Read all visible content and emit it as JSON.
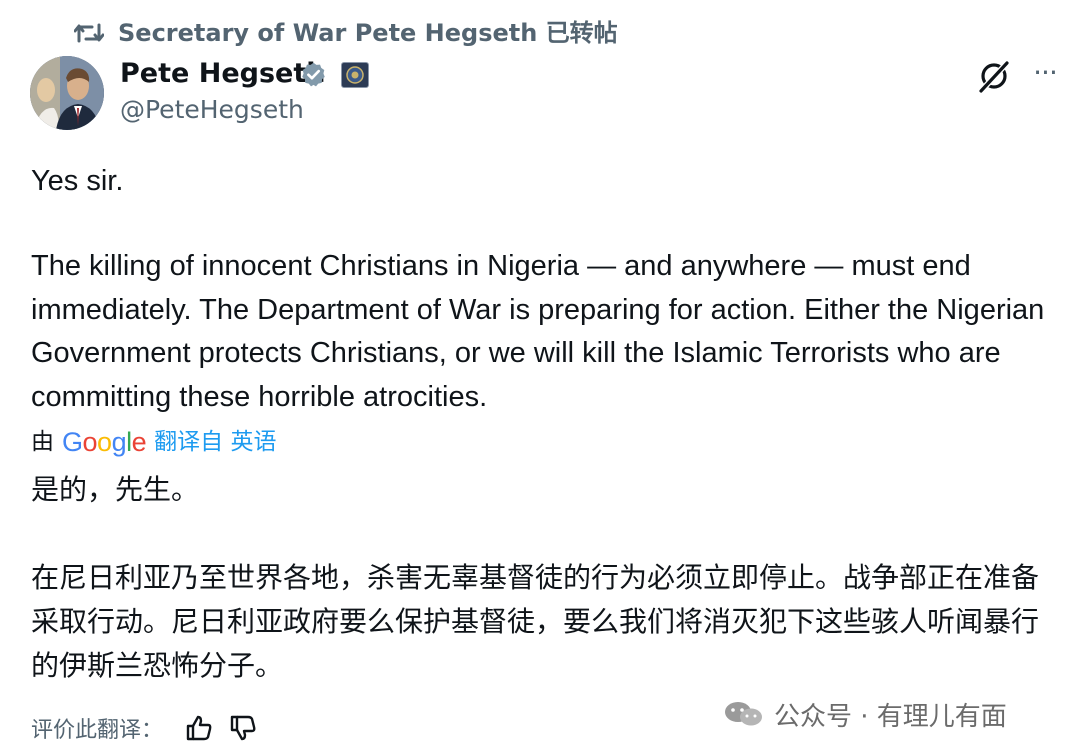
{
  "repost": {
    "text": "Secretary of War Pete Hegseth 已转帖",
    "icon": "repost-icon"
  },
  "author": {
    "display_name": "Pete Hegseth",
    "handle": "@PeteHegseth",
    "verified_icon": "verified-badge-icon",
    "affiliation_icon": "department-seal-icon"
  },
  "header_actions": {
    "grok_icon": "grok-icon",
    "more_label": "···"
  },
  "tweet": {
    "paragraph_1": "Yes sir.",
    "paragraph_2": "The killing of innocent Christians in Nigeria — and anywhere — must end immediately. The Department of War is preparing for action. Either the Nigerian Government protects Christians, or we will kill the Islamic Terrorists who are committing these horrible atrocities."
  },
  "translation": {
    "prefix": "由",
    "provider": "Google",
    "suffix": "翻译自 英语",
    "paragraph_1": "是的，先生。",
    "paragraph_2": "在尼日利亚乃至世界各地，杀害无辜基督徒的行为必须立即停止。战争部正在准备采取行动。尼日利亚政府要么保护基督徒，要么我们将消灭犯下这些骇人听闻暴行的伊斯兰恐怖分子。",
    "rate_label": "评价此翻译：",
    "thumbs_up_icon": "thumbs-up-icon",
    "thumbs_down_icon": "thumbs-down-icon"
  },
  "watermark": {
    "text": "公众号 · 有理儿有面",
    "icon": "wechat-icon"
  },
  "colors": {
    "text_primary": "#0f1419",
    "text_secondary": "#536471",
    "link_blue": "#1d9bf0",
    "verified_gray": "#829aab"
  }
}
